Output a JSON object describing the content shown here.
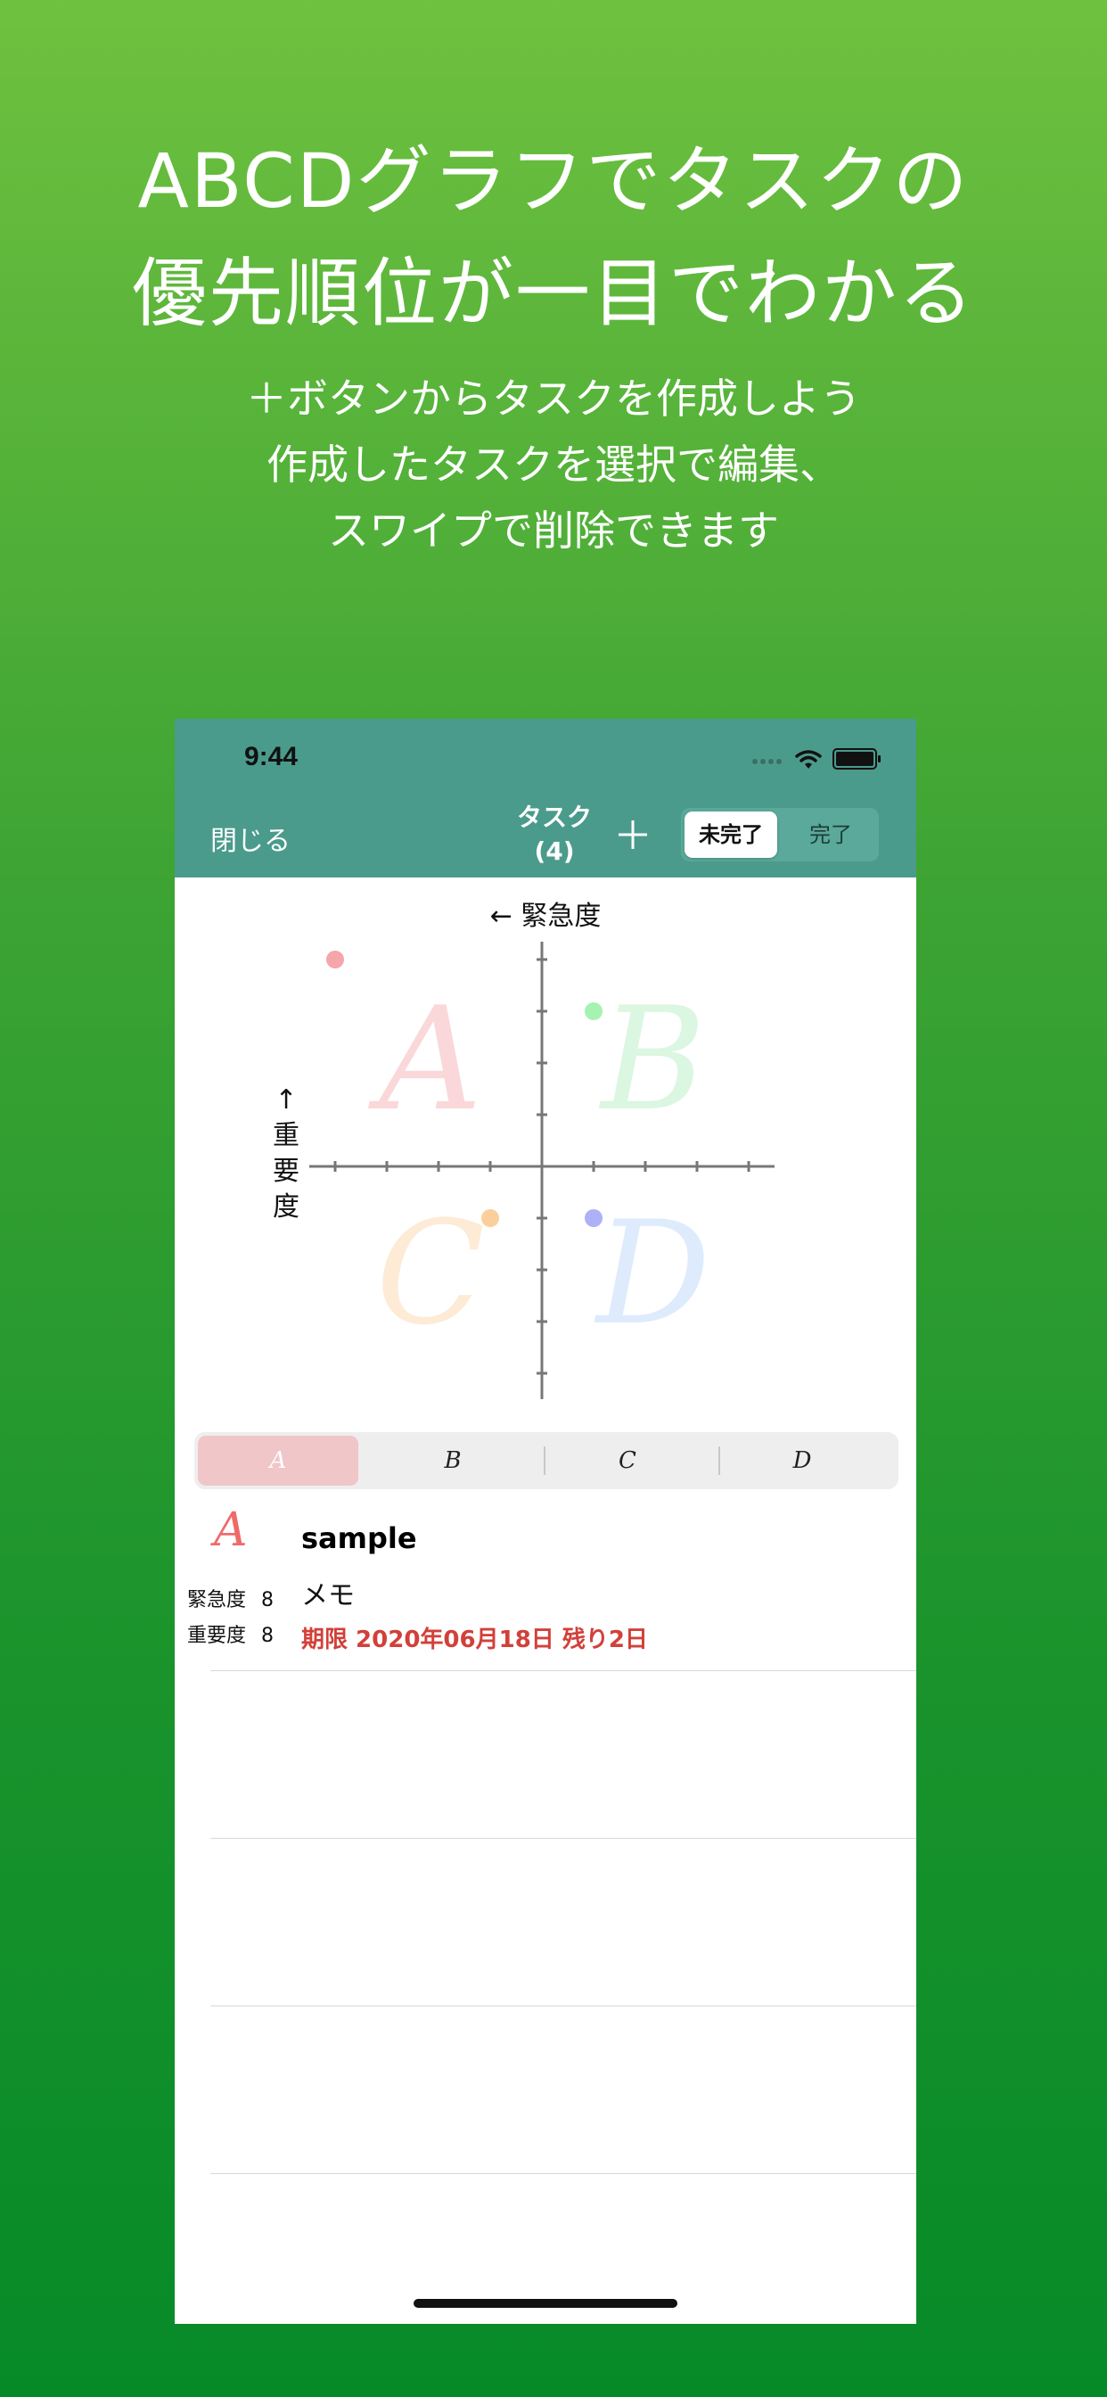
{
  "promo": {
    "headline_line1": "ABCDグラフでタスクの",
    "headline_line2": "優先順位が一目でわかる",
    "sub_line1": "＋ボタンからタスクを作成しよう",
    "sub_line2": "作成したタスクを選択で編集、",
    "sub_line3": "スワイプで削除できます"
  },
  "status_bar": {
    "time": "9:44"
  },
  "nav": {
    "close_label": "閉じる",
    "title_line1": "タスク",
    "title_line2": "(4)",
    "segment": {
      "incomplete": "未完了",
      "complete": "完了",
      "selected": "未完了"
    }
  },
  "chart_data": {
    "type": "scatter",
    "xlabel": "← 緊急度",
    "ylabel": [
      "↑",
      "重",
      "要",
      "度"
    ],
    "quadrant_labels": [
      "A",
      "B",
      "C",
      "D"
    ],
    "quadrant_colors": {
      "A": "#f6b9bd",
      "B": "#bfefc9",
      "C": "#fddcb6",
      "D": "#c4dbfb"
    },
    "points": [
      {
        "quadrant": "A",
        "urgency": 8,
        "importance": 8,
        "color": "#f4a6aa"
      },
      {
        "quadrant": "B",
        "urgency": -1,
        "importance": 3,
        "color": "#a6f2b0"
      },
      {
        "quadrant": "C",
        "urgency": 1,
        "importance": -1,
        "color": "#fbcf9c"
      },
      {
        "quadrant": "D",
        "urgency": -1,
        "importance": -1,
        "color": "#adb1f7"
      }
    ],
    "xlim": [
      -4,
      4
    ],
    "ylim": [
      -4,
      4
    ]
  },
  "filter": {
    "options": [
      "A",
      "B",
      "C",
      "D"
    ],
    "selected": "A"
  },
  "tasks": [
    {
      "grade": "A",
      "urgency_label": "緊急度",
      "urgency": "8",
      "importance_label": "重要度",
      "importance": "8",
      "title": "sample",
      "memo": "メモ",
      "due": "期限 2020年06月18日 残り2日"
    }
  ]
}
